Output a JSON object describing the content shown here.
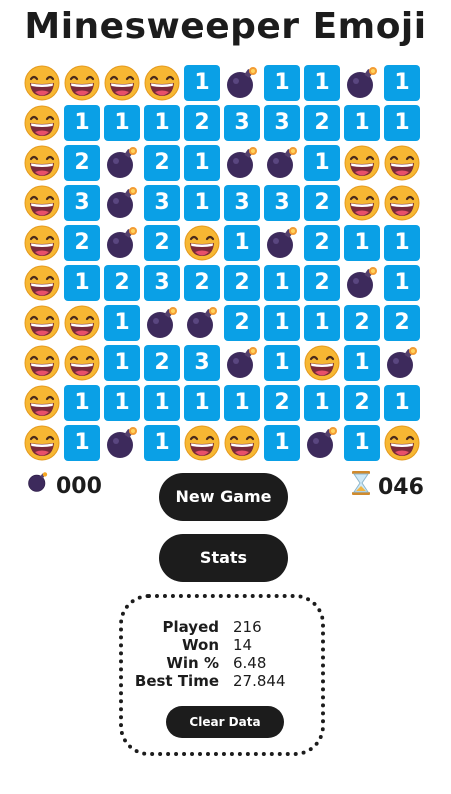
{
  "title": "Minesweeper Emoji",
  "board": [
    [
      "E",
      "E",
      "E",
      "E",
      "1",
      "B",
      "1",
      "1",
      "B",
      "1"
    ],
    [
      "E",
      "1",
      "1",
      "1",
      "2",
      "3",
      "3",
      "2",
      "1",
      "1"
    ],
    [
      "E",
      "2",
      "B",
      "2",
      "1",
      "B",
      "B",
      "1",
      "E",
      "E"
    ],
    [
      "E",
      "3",
      "B",
      "3",
      "1",
      "3",
      "3",
      "2",
      "E",
      "E"
    ],
    [
      "E",
      "2",
      "B",
      "2",
      "E",
      "1",
      "B",
      "2",
      "1",
      "1"
    ],
    [
      "E",
      "1",
      "2",
      "3",
      "2",
      "2",
      "1",
      "2",
      "B",
      "1"
    ],
    [
      "E",
      "E",
      "1",
      "B",
      "B",
      "2",
      "1",
      "1",
      "2",
      "2"
    ],
    [
      "E",
      "E",
      "1",
      "2",
      "3",
      "B",
      "1",
      "E",
      "1",
      "B"
    ],
    [
      "E",
      "1",
      "1",
      "1",
      "1",
      "1",
      "2",
      "1",
      "2",
      "1"
    ],
    [
      "E",
      "1",
      "B",
      "1",
      "E",
      "E",
      "1",
      "B",
      "1",
      "E"
    ]
  ],
  "legend": {
    "E": "grinning-face-emoji",
    "B": "bomb-emoji",
    "number_tile_color": "#0aa0e6"
  },
  "counters": {
    "mines": "000",
    "mines_icon": "bomb-icon",
    "timer": "046",
    "timer_icon": "hourglass-icon"
  },
  "buttons": {
    "new_game": "New Game",
    "stats": "Stats",
    "clear_data": "Clear Data"
  },
  "stats": [
    {
      "label": "Played",
      "value": "216"
    },
    {
      "label": "Won",
      "value": "14"
    },
    {
      "label": "Win %",
      "value": "6.48"
    },
    {
      "label": "Best Time",
      "value": "27.844"
    }
  ]
}
